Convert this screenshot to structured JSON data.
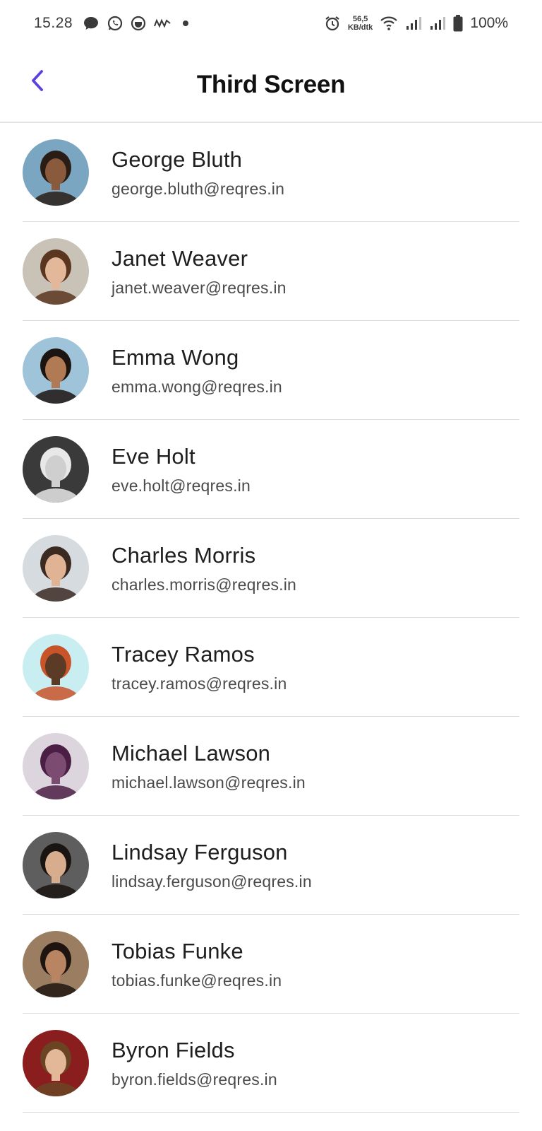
{
  "status_bar": {
    "time": "15.28",
    "net_speed_value": "56,5",
    "net_speed_unit": "KB/dtk",
    "battery": "100%",
    "icons": [
      "chat-icon",
      "whatsapp-icon",
      "app-icon",
      "uno-icon",
      "dot-icon",
      "alarm-icon",
      "wifi-icon",
      "signal-icon",
      "signal-icon",
      "battery-icon"
    ]
  },
  "app_bar": {
    "title": "Third Screen",
    "back_icon": "chevron-left-icon",
    "accent_color": "#5b3fe0"
  },
  "users": [
    {
      "name": "George Bluth",
      "email": "george.bluth@reqres.in",
      "avatar_bg": "#7aa6c2",
      "avatar_skin": "#8a5a3c",
      "avatar_hair": "#2a1d16"
    },
    {
      "name": "Janet Weaver",
      "email": "janet.weaver@reqres.in",
      "avatar_bg": "#c9c2b6",
      "avatar_skin": "#e3b89a",
      "avatar_hair": "#5a3520"
    },
    {
      "name": "Emma Wong",
      "email": "emma.wong@reqres.in",
      "avatar_bg": "#9fc3d8",
      "avatar_skin": "#b07a55",
      "avatar_hair": "#1c1410"
    },
    {
      "name": "Eve Holt",
      "email": "eve.holt@reqres.in",
      "avatar_bg": "#3a3a3a",
      "avatar_skin": "#cfcfcf",
      "avatar_hair": "#e8e8e8"
    },
    {
      "name": "Charles Morris",
      "email": "charles.morris@reqres.in",
      "avatar_bg": "#d6dbe0",
      "avatar_skin": "#e0b394",
      "avatar_hair": "#3b2a22"
    },
    {
      "name": "Tracey Ramos",
      "email": "tracey.ramos@reqres.in",
      "avatar_bg": "#c9eef2",
      "avatar_skin": "#5b3a26",
      "avatar_hair": "#c9542a"
    },
    {
      "name": "Michael Lawson",
      "email": "michael.lawson@reqres.in",
      "avatar_bg": "#ddd5de",
      "avatar_skin": "#7b4b72",
      "avatar_hair": "#4b1f45"
    },
    {
      "name": "Lindsay Ferguson",
      "email": "lindsay.ferguson@reqres.in",
      "avatar_bg": "#5e5e5e",
      "avatar_skin": "#d8ad8e",
      "avatar_hair": "#1a1412"
    },
    {
      "name": "Tobias Funke",
      "email": "tobias.funke@reqres.in",
      "avatar_bg": "#9b7e62",
      "avatar_skin": "#b98462",
      "avatar_hair": "#1e1510"
    },
    {
      "name": "Byron Fields",
      "email": "byron.fields@reqres.in",
      "avatar_bg": "#8a1e1e",
      "avatar_skin": "#e2b898",
      "avatar_hair": "#6b4424"
    }
  ]
}
